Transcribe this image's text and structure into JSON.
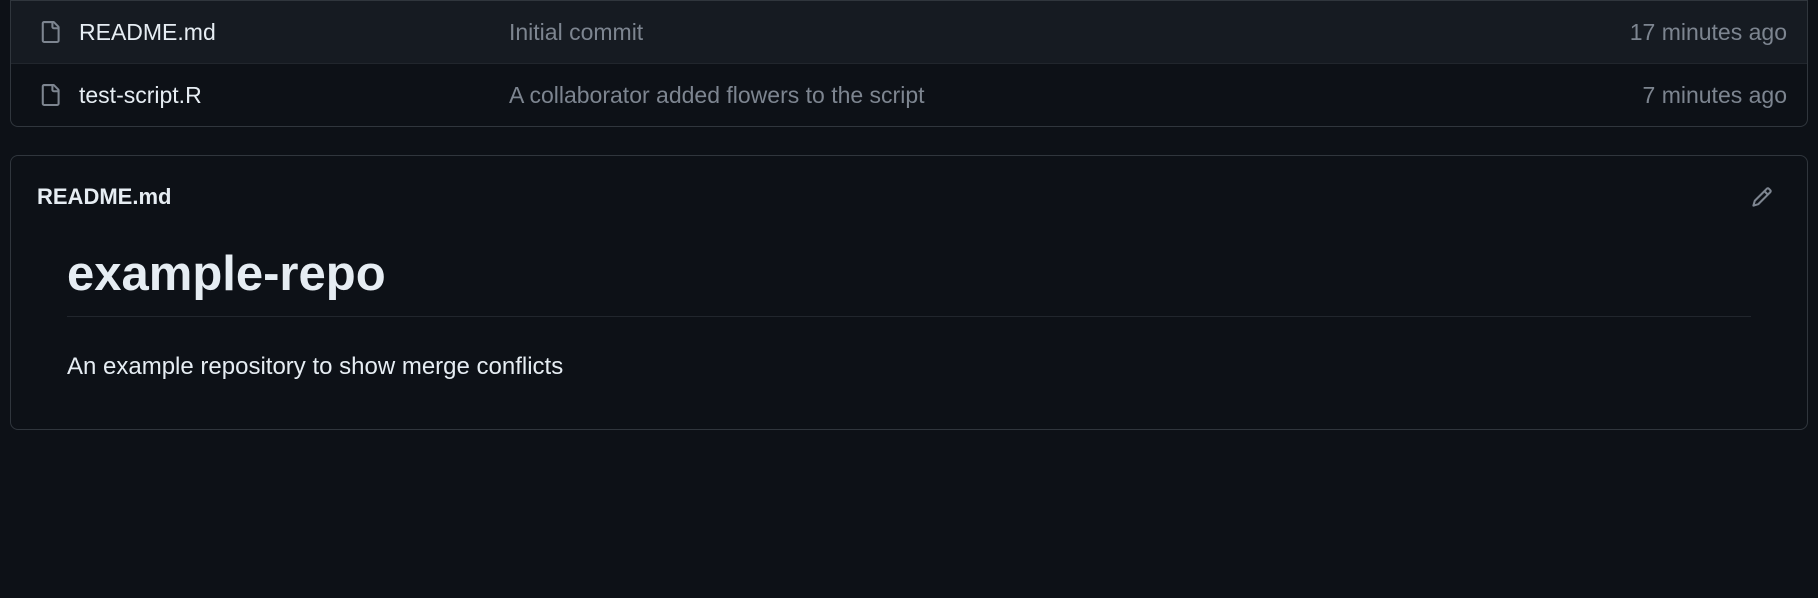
{
  "files": [
    {
      "name": "README.md",
      "commit_message": "Initial commit",
      "age": "17 minutes ago"
    },
    {
      "name": "test-script.R",
      "commit_message": "A collaborator added flowers to the script",
      "age": "7 minutes ago"
    }
  ],
  "readme": {
    "filename": "README.md",
    "heading": "example-repo",
    "description": "An example repository to show merge conflicts"
  }
}
